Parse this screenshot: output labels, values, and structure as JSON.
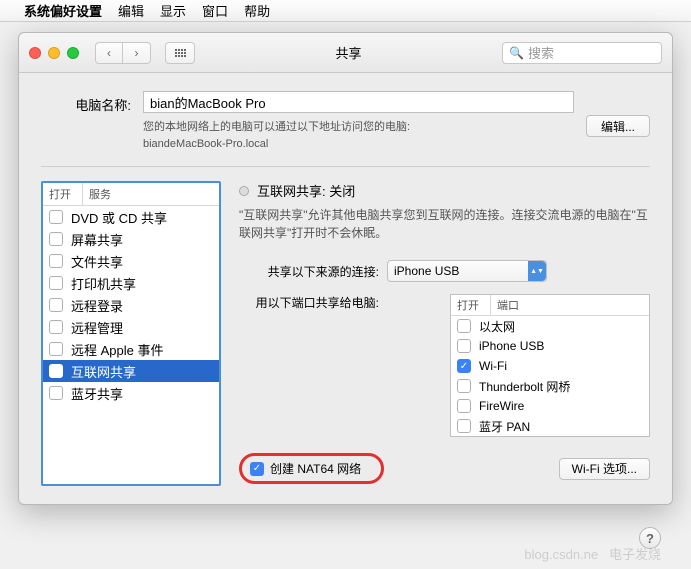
{
  "menubar": {
    "app": "系统偏好设置",
    "items": [
      "编辑",
      "显示",
      "窗口",
      "帮助"
    ]
  },
  "window": {
    "title": "共享",
    "search_placeholder": "搜索"
  },
  "computer_name": {
    "label": "电脑名称:",
    "value": "bian的MacBook Pro",
    "desc_line1": "您的本地网络上的电脑可以通过以下地址访问您的电脑:",
    "desc_line2": "biandeMacBook-Pro.local",
    "edit_button": "编辑..."
  },
  "services": {
    "header_on": "打开",
    "header_name": "服务",
    "items": [
      {
        "label": "DVD 或 CD 共享",
        "on": false
      },
      {
        "label": "屏幕共享",
        "on": false
      },
      {
        "label": "文件共享",
        "on": false
      },
      {
        "label": "打印机共享",
        "on": false
      },
      {
        "label": "远程登录",
        "on": false
      },
      {
        "label": "远程管理",
        "on": false
      },
      {
        "label": "远程 Apple 事件",
        "on": false
      },
      {
        "label": "互联网共享",
        "on": false,
        "selected": true
      },
      {
        "label": "蓝牙共享",
        "on": false
      }
    ]
  },
  "detail": {
    "title": "互联网共享: 关闭",
    "desc": "\"互联网共享\"允许其他电脑共享您到互联网的连接。连接交流电源的电脑在\"互联网共享\"打开时不会休眠。",
    "share_from_label": "共享以下来源的连接:",
    "share_from_value": "iPhone USB",
    "share_to_label": "用以下端口共享给电脑:",
    "ports_header_on": "打开",
    "ports_header_name": "端口",
    "ports": [
      {
        "label": "以太网",
        "on": false
      },
      {
        "label": "iPhone USB",
        "on": false
      },
      {
        "label": "Wi-Fi",
        "on": true
      },
      {
        "label": "Thunderbolt 网桥",
        "on": false
      },
      {
        "label": "FireWire",
        "on": false
      },
      {
        "label": "蓝牙 PAN",
        "on": false
      }
    ],
    "nat64_label": "创建 NAT64 网络",
    "nat64_on": true,
    "wifi_options_button": "Wi-Fi 选项..."
  },
  "watermark": "blog.csdn.ne",
  "watermark2": "电子发烧"
}
